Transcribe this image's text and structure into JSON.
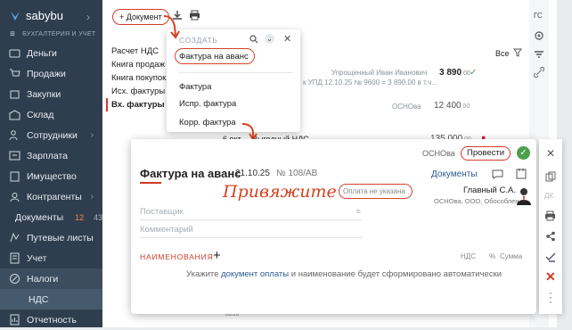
{
  "sidebar": {
    "logo_text": "sabybu",
    "subtitle": "БУХГАЛТЕРИЯ И УЧЕТ",
    "items": [
      {
        "label": "Деньги",
        "icon": "wallet-icon"
      },
      {
        "label": "Продажи",
        "icon": "cart-icon"
      },
      {
        "label": "Закупки",
        "icon": "box-icon"
      },
      {
        "label": "Склад",
        "icon": "warehouse-icon"
      },
      {
        "label": "Сотрудники",
        "icon": "users-icon",
        "chevron": true
      },
      {
        "label": "Зарплата",
        "icon": "salary-icon"
      },
      {
        "label": "Имущество",
        "icon": "building-icon"
      },
      {
        "label": "Контрагенты",
        "icon": "contacts-icon",
        "chevron": true
      },
      {
        "label": "Документы",
        "icon": "documents-icon",
        "badge_a": "12",
        "badge_b": "43"
      },
      {
        "label": "Путевые листы",
        "icon": "route-icon"
      },
      {
        "label": "Учет",
        "icon": "ledger-icon"
      },
      {
        "label": "Налоги",
        "icon": "tax-icon"
      },
      {
        "label": "НДС",
        "icon": ""
      },
      {
        "label": "Отчетность",
        "icon": "report-icon"
      }
    ]
  },
  "toolbar": {
    "add_document": "+ Документ"
  },
  "left_list": [
    "Расчет НДС",
    "Книга продаж",
    "Книга покупок",
    "Исх. фактуры",
    "Вх. фактуры"
  ],
  "create_popup": {
    "title": "СОЗДАТЬ",
    "items": [
      "Фактура на аванс",
      "Фактура",
      "Испр. фактура",
      "Корр. фактура"
    ]
  },
  "bg_rows": {
    "all_label": "Все",
    "row1_partner": "Упрощенный Иван Иванович",
    "row1_sum": "3 890",
    "row1_sum_dec": "00",
    "row1_note": "к УПД 12.10.25 № 9600 = 3 890.00 в т.ч...",
    "row2_label": "ОСНОва",
    "row2_sum": "12 400",
    "row2_sum_dec": "00",
    "row3_date": "6 окт",
    "row3_vat": "Выгодный НДС",
    "row3_sum": "135 000",
    "row3_sum_dec": "00",
    "footer_fragment": "вв3в"
  },
  "dialog": {
    "org": "ОСНОва",
    "post_button": "Провести",
    "title": "Фактура на аванс",
    "date": "21.10.25",
    "number": "№ 108/АВ",
    "documents_link": "Документы",
    "payment_placeholder": "Оплата не указана",
    "annotation": "Привяжите",
    "signer_name": "Главный С.А.",
    "signer_org": "ОСНОва, ООО, Обособлен...",
    "supplier_placeholder": "Поставщик",
    "comment_placeholder": "Комментарий",
    "items_header": "НАИМЕНОВАНИЯ",
    "col_vat": "НДС",
    "col_vat_pct": "%",
    "col_sum": "Сумма",
    "hint_before": "Укажите ",
    "hint_link": "документ оплаты",
    "hint_after": " и наименование будет сформировано автоматически"
  },
  "right_tools": {
    "top_label": "ГС"
  }
}
